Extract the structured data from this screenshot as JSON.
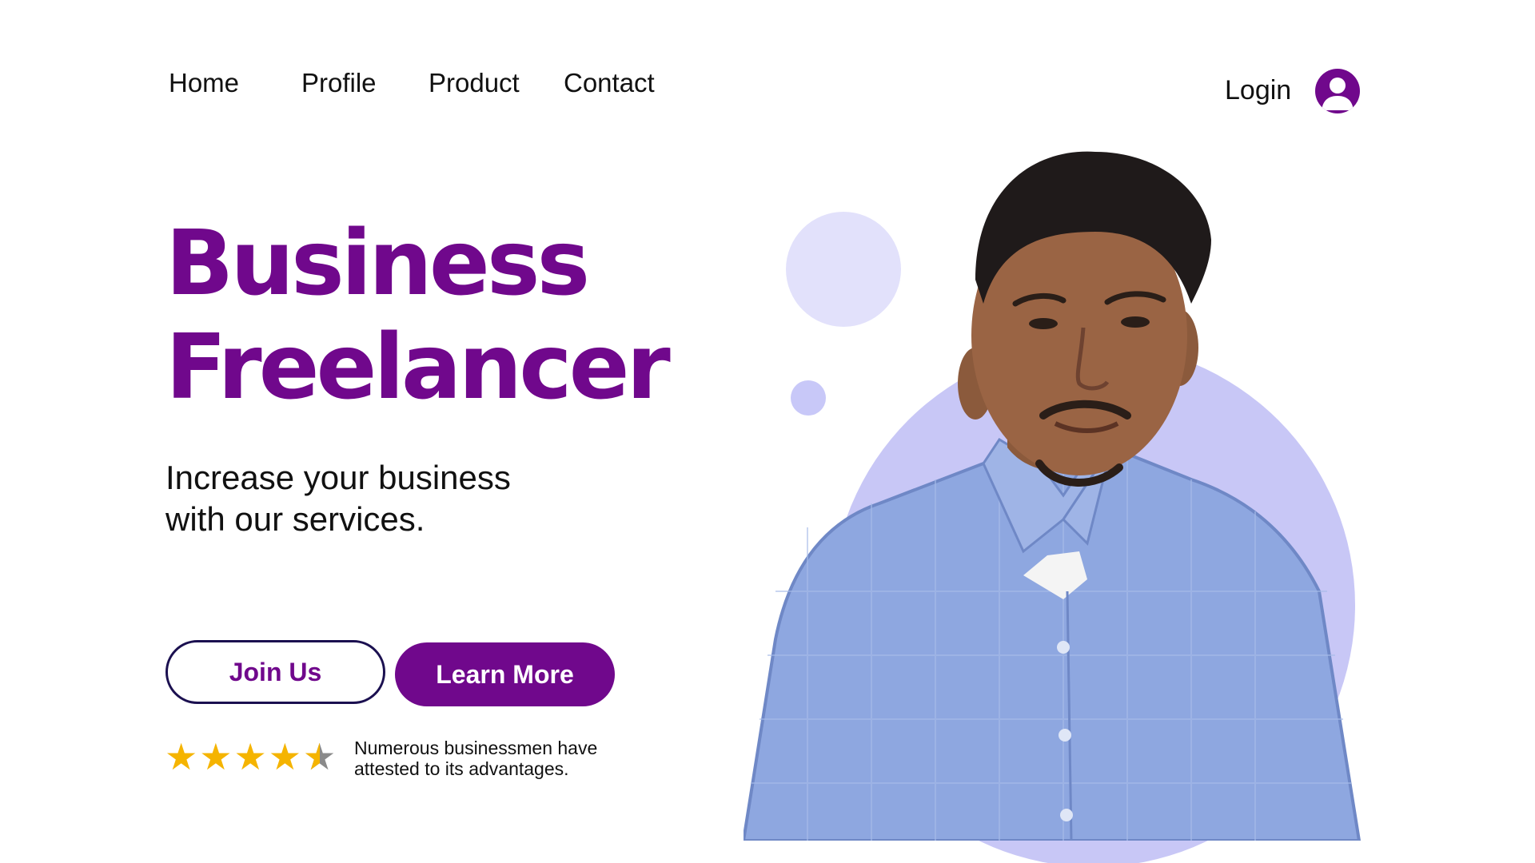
{
  "nav": {
    "items": [
      {
        "label": "Home"
      },
      {
        "label": "Profile"
      },
      {
        "label": "Product"
      },
      {
        "label": "Contact"
      }
    ],
    "login_label": "Login",
    "avatar_icon": "user-avatar-icon"
  },
  "hero": {
    "title_line1": "Business",
    "title_line2": "Freelancer",
    "subtitle_line1": "Increase your business",
    "subtitle_line2": "with our services."
  },
  "buttons": {
    "join_label": "Join Us",
    "learn_label": "Learn More"
  },
  "rating": {
    "value": 4.5,
    "max": 5,
    "text_line1": "Numerous businessmen have",
    "text_line2": "attested to its advantages."
  },
  "colors": {
    "brand_purple": "#70088c",
    "navy_border": "#1b1050",
    "lavender_circle": "#c8c7f6",
    "pale_circle": "#e2e1fb",
    "star_gold": "#f5b400",
    "shirt_blue": "#8ea7e0"
  }
}
